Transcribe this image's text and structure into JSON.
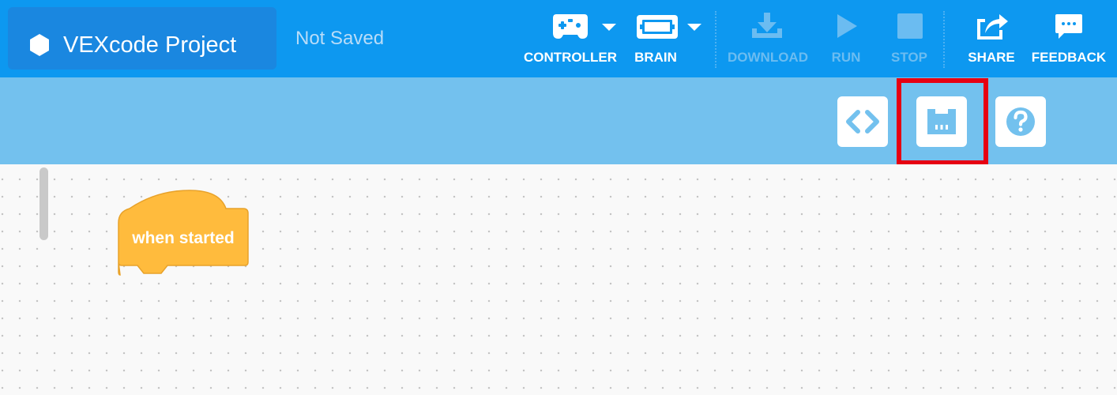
{
  "header": {
    "project_title": "VEXcode Project",
    "save_status": "Not Saved",
    "project_icon": "hexagon-icon"
  },
  "toolbar": {
    "controller": {
      "label": "CONTROLLER",
      "icon": "gamepad-icon",
      "enabled": true
    },
    "brain": {
      "label": "BRAIN",
      "icon": "brain-icon",
      "enabled": true
    },
    "download": {
      "label": "DOWNLOAD",
      "icon": "download-icon",
      "enabled": false
    },
    "run": {
      "label": "RUN",
      "icon": "play-icon",
      "enabled": false
    },
    "stop": {
      "label": "STOP",
      "icon": "stop-icon",
      "enabled": false
    },
    "share": {
      "label": "SHARE",
      "icon": "share-icon",
      "enabled": true
    },
    "feedback": {
      "label": "FEEDBACK",
      "icon": "feedback-icon",
      "enabled": true
    }
  },
  "subtoolbar": {
    "buttons": [
      {
        "name": "code-view",
        "icon": "code-brackets-icon"
      },
      {
        "name": "devices",
        "icon": "device-port-icon",
        "highlighted": true
      },
      {
        "name": "help",
        "icon": "question-icon"
      }
    ]
  },
  "workspace": {
    "blocks": [
      {
        "type": "hat",
        "text": "when started"
      }
    ]
  },
  "colors": {
    "topbar": "#0d98f0",
    "project_box": "#1a87e0",
    "subbar": "#73c1ee",
    "hat_block": "#ffbb3d",
    "highlight": "#e60012",
    "disabled_label": "#6bbcf1"
  }
}
